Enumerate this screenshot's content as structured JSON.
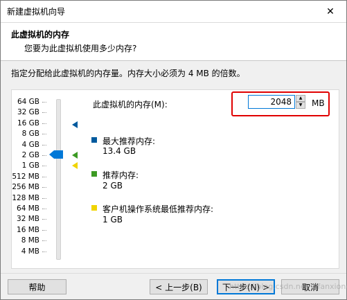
{
  "window": {
    "title": "新建虚拟机向导",
    "close_glyph": "✕"
  },
  "header": {
    "title": "此虚拟机的内存",
    "subtitle": "您要为此虚拟机使用多少内存?"
  },
  "description": "指定分配给此虚拟机的内存量。内存大小必须为 4 MB 的倍数。",
  "scale": {
    "labels": [
      "64 GB",
      "32 GB",
      "16 GB",
      "8 GB",
      "4 GB",
      "2 GB",
      "1 GB",
      "512 MB",
      "256 MB",
      "128 MB",
      "64 MB",
      "32 MB",
      "16 MB",
      "8 MB",
      "4 MB"
    ],
    "current_label": "2 GB"
  },
  "memory": {
    "label": "此虚拟机的内存(M):",
    "value": "2048",
    "unit": "MB"
  },
  "legend": {
    "max": {
      "title": "最大推荐内存:",
      "value": "13.4 GB",
      "color": "#005a9e"
    },
    "recommended": {
      "title": "推荐内存:",
      "value": "2 GB",
      "color": "#3c9a23"
    },
    "guest_min": {
      "title": "客户机操作系统最低推荐内存:",
      "value": "1 GB",
      "color": "#f0d400"
    }
  },
  "buttons": {
    "help": "帮助",
    "back": "< 上一步(B)",
    "next": "下一步(N) >",
    "cancel": "取消"
  },
  "watermark": "https://blog.csdn.net/lafanxiong"
}
